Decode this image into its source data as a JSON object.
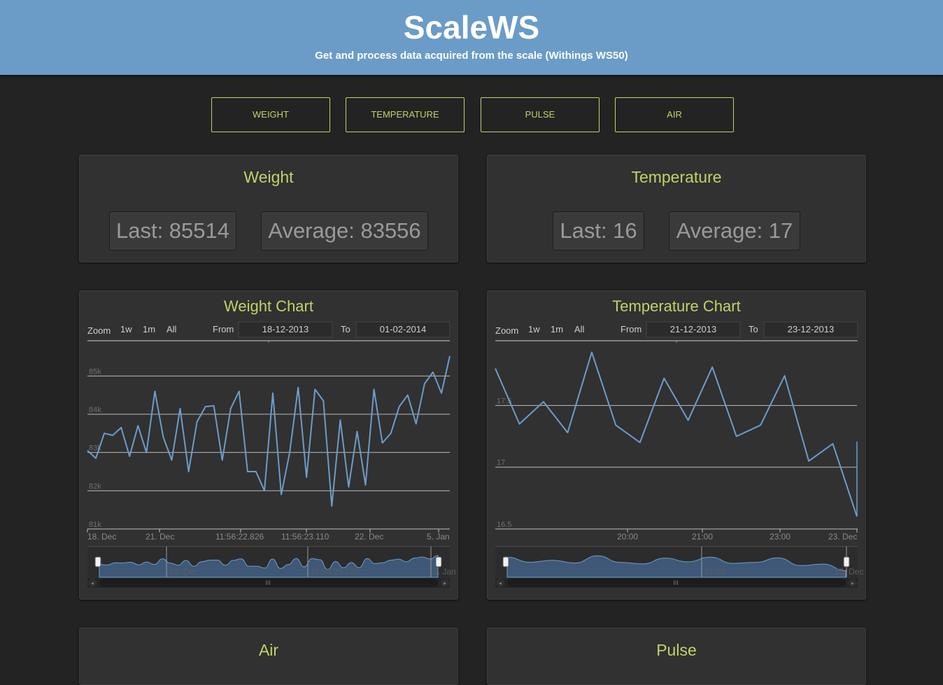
{
  "header": {
    "title": "ScaleWS",
    "subtitle": "Get and process data acquired from the scale (Withings WS50)"
  },
  "nav": {
    "weight_label": "WEIGHT",
    "temperature_label": "TEMPERATURE",
    "pulse_label": "PULSE",
    "air_label": "AIR"
  },
  "weight_stats": {
    "title": "Weight",
    "last": "Last: 85514",
    "average": "Average: 83556"
  },
  "temperature_stats": {
    "title": "Temperature",
    "last": "Last: 16",
    "average": "Average: 17"
  },
  "weight_chart": {
    "title": "Weight Chart",
    "zoom_label": "Zoom",
    "zoom_buttons": [
      "1w",
      "1m",
      "All"
    ],
    "from_label": "From",
    "from_value": "18-12-2013",
    "to_label": "To",
    "to_value": "01-02-2014",
    "x_tick_labels": [
      "18. Dec",
      "21. Dec",
      "11:56:22.826",
      "11:56:23.110",
      "22. Dec",
      "5. Jan"
    ],
    "navigator_labels": [
      "21. Dec",
      "11:56:23.120",
      "5. Jan"
    ],
    "line_color": "#6e9cc8"
  },
  "temperature_chart": {
    "title": "Temperature Chart",
    "zoom_label": "Zoom",
    "zoom_buttons": [
      "1w",
      "1m",
      "All"
    ],
    "from_label": "From",
    "from_value": "21-12-2013",
    "to_label": "To",
    "to_value": "23-12-2013",
    "x_tick_labels": [
      "20:00",
      "21:00",
      "23:00",
      "23. Dec"
    ],
    "navigator_labels": [
      "21:00",
      "23. Dec"
    ],
    "line_color": "#6e9cc8"
  },
  "chart_data": [
    {
      "type": "line",
      "title": "Weight Chart",
      "ylim": [
        81000,
        85500
      ],
      "y_ticks": [
        81000,
        82000,
        83000,
        84000,
        85000
      ],
      "y_tick_labels": [
        "81k",
        "82k",
        "83k",
        "84k",
        "85k"
      ],
      "grid": true,
      "series": [
        {
          "values": [
            83050,
            82850,
            83500,
            83450,
            83650,
            82900,
            83700,
            83000,
            84600,
            83400,
            82800,
            84150,
            82500,
            83800,
            84200,
            84220,
            82800,
            84150,
            84600,
            82500,
            82500,
            82000,
            84550,
            81900,
            83000,
            84700,
            82350,
            84650,
            84350,
            81600,
            83850,
            82100,
            83550,
            82150,
            84650,
            83250,
            83500,
            84200,
            84500,
            83750,
            84800,
            85100,
            84550,
            85520
          ]
        }
      ]
    },
    {
      "type": "line",
      "title": "Temperature Chart",
      "ylim": [
        16.5,
        17.95
      ],
      "y_ticks": [
        16.5,
        17,
        17.5
      ],
      "y_tick_labels": [
        "16.5",
        "17",
        "17.5"
      ],
      "grid": true,
      "series": [
        {
          "values": [
            17.8,
            17.35,
            17.53,
            17.28,
            17.93,
            17.34,
            17.2,
            17.72,
            17.38,
            17.81,
            17.25,
            17.34,
            17.74,
            17.05,
            17.19,
            16.6
          ]
        }
      ]
    }
  ],
  "lower_panels": {
    "air_title": "Air",
    "pulse_title": "Pulse"
  }
}
